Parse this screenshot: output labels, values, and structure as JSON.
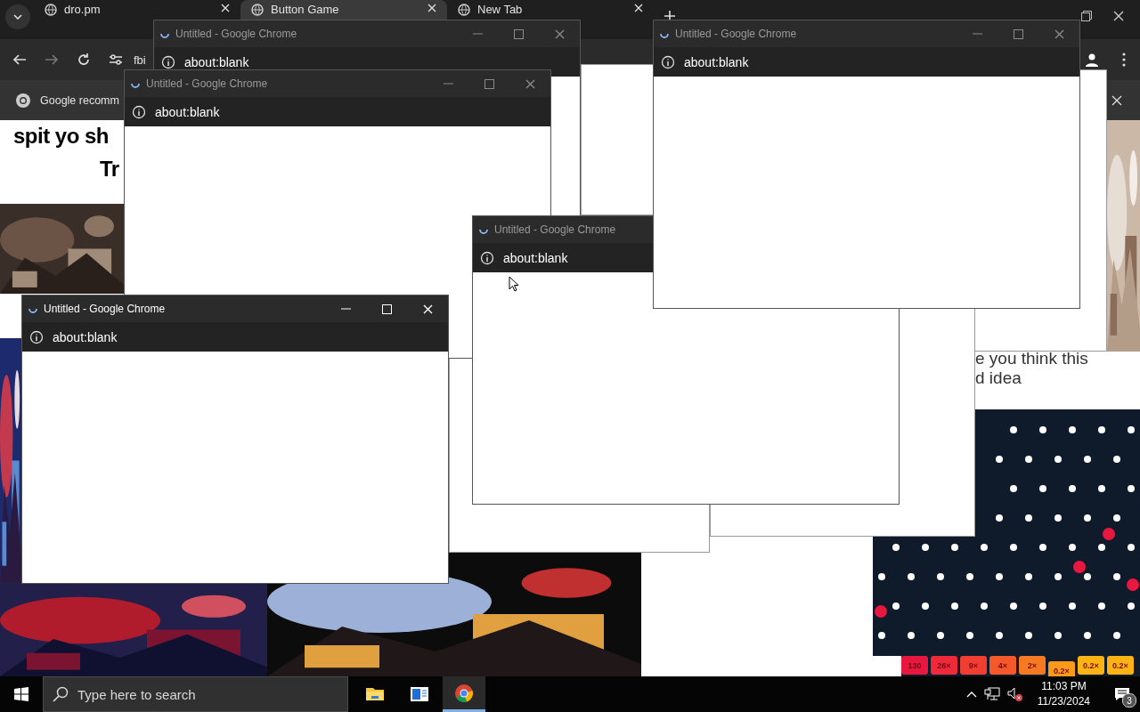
{
  "browser": {
    "tabs": [
      {
        "title": "dro.pm",
        "selected": false
      },
      {
        "title": "Button Game",
        "selected": true
      },
      {
        "title": "New Tab",
        "selected": false
      }
    ],
    "address": "fbi",
    "infobar": "Google recomm"
  },
  "page": {
    "meme_top": [
      "spit yo sh",
      "Tr"
    ],
    "meme_right": [
      "e you think this",
      "d idea"
    ],
    "multipliers": [
      {
        "label": "130",
        "color": "#e8173f"
      },
      {
        "label": "26×",
        "color": "#ee2a3a"
      },
      {
        "label": "9×",
        "color": "#f23d33"
      },
      {
        "label": "4×",
        "color": "#f5582b"
      },
      {
        "label": "2×",
        "color": "#f77a22"
      },
      {
        "label": "0.2×",
        "color": "#f99a1a"
      },
      {
        "label": "0.2×",
        "color": "#fbb314"
      },
      {
        "label": "0.2×",
        "color": "#fbb314"
      }
    ]
  },
  "popups": [
    {
      "title": "Untitled - Google Chrome",
      "url": "about:blank",
      "active": false
    },
    {
      "title": "Untitled - Google Chrome",
      "url": "about:blank",
      "active": false
    },
    {
      "title": "Untitled - Google Chrome",
      "url": "about:blank",
      "active": false
    },
    {
      "title": "Untitled - Google Chrome",
      "url": "about:blank",
      "active": false
    },
    {
      "title": "Untitled - Google Chrome",
      "url": "about:blank",
      "active": true
    }
  ],
  "taskbar": {
    "search_placeholder": "Type here to search",
    "apps": [
      {
        "kind": "folder",
        "selected": false
      },
      {
        "kind": "news",
        "selected": false
      },
      {
        "kind": "chrome",
        "selected": true
      }
    ],
    "time": "11:03 PM",
    "date": "11/23/2024",
    "notifications": "3"
  }
}
